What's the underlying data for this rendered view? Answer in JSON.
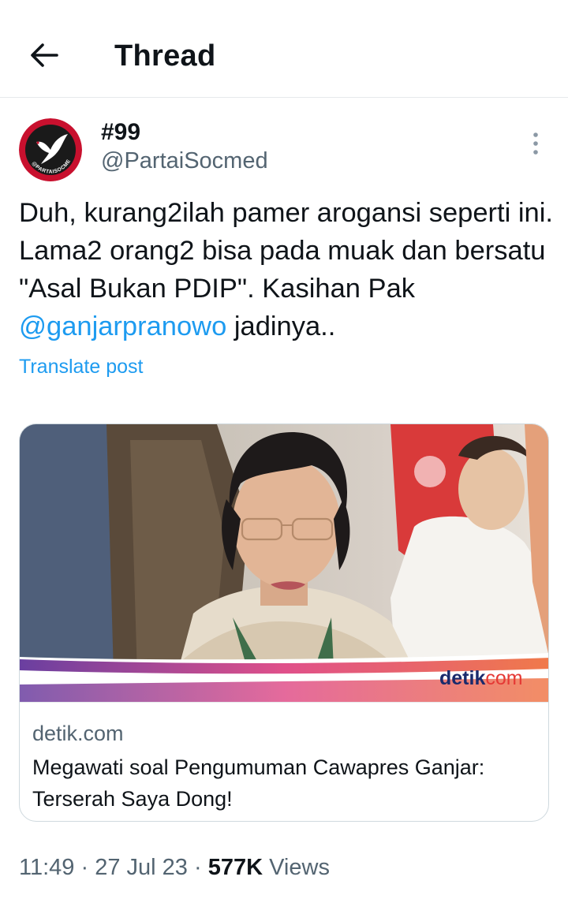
{
  "header": {
    "title": "Thread",
    "back_icon": "arrow-left-icon"
  },
  "author": {
    "display_name": "#99",
    "handle": "@PartaiSocmed",
    "avatar_icon": "dove-logo-avatar",
    "avatar_text": "@PARTAISOCMED",
    "more_icon": "more-vertical-icon"
  },
  "tweet": {
    "text_part1": "Duh, kurang2ilah pamer arogansi seperti ini. Lama2 orang2 bisa pada muak dan bersatu \"Asal Bukan PDIP\". Kasihan Pak ",
    "mention": "@ganjarpranowo",
    "text_part2": " jadinya..",
    "translate_label": "Translate post"
  },
  "link_card": {
    "image_watermark_detik": "detik",
    "image_watermark_com": "com",
    "domain": "detik.com",
    "title": "Megawati soal Pengumuman Cawapres Ganjar: Terserah Saya Dong!"
  },
  "meta": {
    "time": "11:49",
    "separator": "·",
    "date": "27 Jul 23",
    "views_count": "577K",
    "views_label": "Views"
  },
  "colors": {
    "link": "#1d9bf0",
    "secondary_text": "#536471",
    "primary_text": "#0f1419",
    "border": "#cfd9de",
    "detik_red": "#e53935",
    "detik_navy": "#1a2a6c"
  }
}
